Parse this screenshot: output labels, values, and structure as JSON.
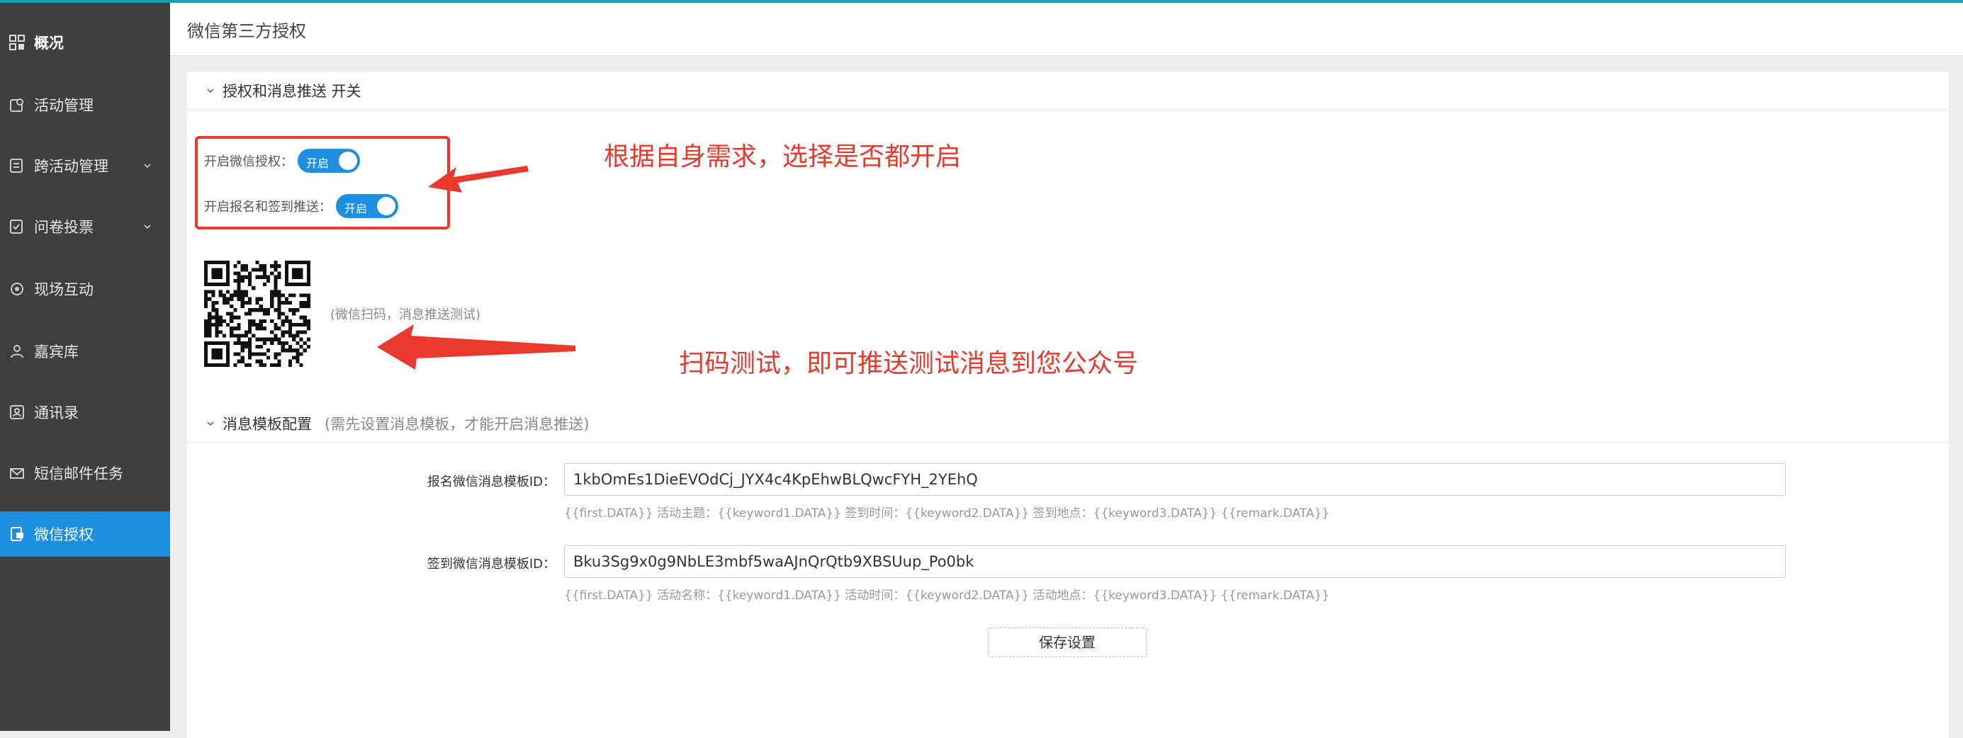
{
  "sidebar": {
    "items": [
      {
        "label": "概况",
        "icon": "dashboard-icon"
      },
      {
        "label": "活动管理",
        "icon": "activity-icon"
      },
      {
        "label": "跨活动管理",
        "icon": "cross-activity-icon",
        "expandable": true
      },
      {
        "label": "问卷投票",
        "icon": "survey-icon",
        "expandable": true
      },
      {
        "label": "现场互动",
        "icon": "interaction-icon"
      },
      {
        "label": "嘉宾库",
        "icon": "guest-icon"
      },
      {
        "label": "通讯录",
        "icon": "contacts-icon"
      },
      {
        "label": "短信邮件任务",
        "icon": "mail-icon"
      },
      {
        "label": "微信授权",
        "icon": "wechat-auth-icon",
        "active": true
      }
    ]
  },
  "header": {
    "title": "微信第三方授权"
  },
  "section1": {
    "title": "授权和消息推送 开关",
    "auth_label": "开启微信授权：",
    "auth_toggle": "开启",
    "push_label": "开启报名和签到推送：",
    "push_toggle": "开启",
    "qr_note": "(微信扫码，消息推送测试)"
  },
  "annotations": {
    "note1": "根据自身需求，选择是否都开启",
    "note2": "扫码测试，即可推送测试消息到您公众号"
  },
  "section2": {
    "title": "消息模板配置",
    "hint": "(需先设置消息模板，才能开启消息推送)",
    "signup_label": "报名微信消息模板ID：",
    "signup_value": "1kbOmEs1DieEVOdCj_JYX4c4KpEhwBLQwcFYH_2YEhQ",
    "signup_help": "{{first.DATA}} 活动主题：{{keyword1.DATA}} 签到时间：{{keyword2.DATA}} 签到地点：{{keyword3.DATA}} {{remark.DATA}}",
    "checkin_label": "签到微信消息模板ID：",
    "checkin_value": "Bku3Sg9x0g9NbLE3mbf5waAJnQrQtb9XBSUup_Po0bk",
    "checkin_help": "{{first.DATA}} 活动名称：{{keyword1.DATA}} 活动时间：{{keyword2.DATA}} 活动地点：{{keyword3.DATA}} {{remark.DATA}}",
    "save_label": "保存设置"
  },
  "colors": {
    "accent": "#1e8fe0",
    "annotation": "#e8392c",
    "sidebar_bg": "#3f3f3f"
  }
}
